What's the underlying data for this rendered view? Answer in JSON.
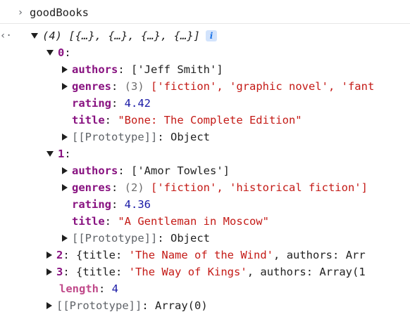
{
  "command": {
    "prompt_icon": "chevron-right-icon",
    "text": "goodBooks"
  },
  "result": {
    "return_icon": "return-arrow-icon",
    "summary_count": "(4)",
    "summary_items": "[{…}, {…}, {…}, {…}]",
    "info_label": "i"
  },
  "items": [
    {
      "index": "0",
      "authors_key": "authors",
      "authors_value": "['Jeff Smith']",
      "genres_key": "genres",
      "genres_count": "(3)",
      "genres_value": "['fiction', 'graphic novel', 'fant",
      "rating_key": "rating",
      "rating_value": "4.42",
      "title_key": "title",
      "title_value": "\"Bone: The Complete Edition\"",
      "proto_key": "[[Prototype]]",
      "proto_value": "Object"
    },
    {
      "index": "1",
      "authors_key": "authors",
      "authors_value": "['Amor Towles']",
      "genres_key": "genres",
      "genres_count": "(2)",
      "genres_value": "['fiction', 'historical fiction']",
      "rating_key": "rating",
      "rating_value": "4.36",
      "title_key": "title",
      "title_value": "\"A Gentleman in Moscow\"",
      "proto_key": "[[Prototype]]",
      "proto_value": "Object"
    }
  ],
  "collapsed": [
    {
      "index": "2",
      "open": "{",
      "title_key": "title",
      "title_value": "'The Name of the Wind'",
      "authors_key": "authors",
      "authors_value": "Arr"
    },
    {
      "index": "3",
      "open": "{",
      "title_key": "title",
      "title_value": "'The Way of Kings'",
      "authors_key": "authors",
      "authors_value": "Array(1"
    }
  ],
  "length": {
    "key": "length",
    "value": "4"
  },
  "array_proto": {
    "key": "[[Prototype]]",
    "value": "Array(0)"
  },
  "colors": {
    "key": "#881280",
    "string": "#c41a16",
    "number": "#1a1aa6",
    "length_key": "#c04a8a",
    "info_badge_bg": "#d2e3fc",
    "info_badge_fg": "#1a73e8"
  }
}
